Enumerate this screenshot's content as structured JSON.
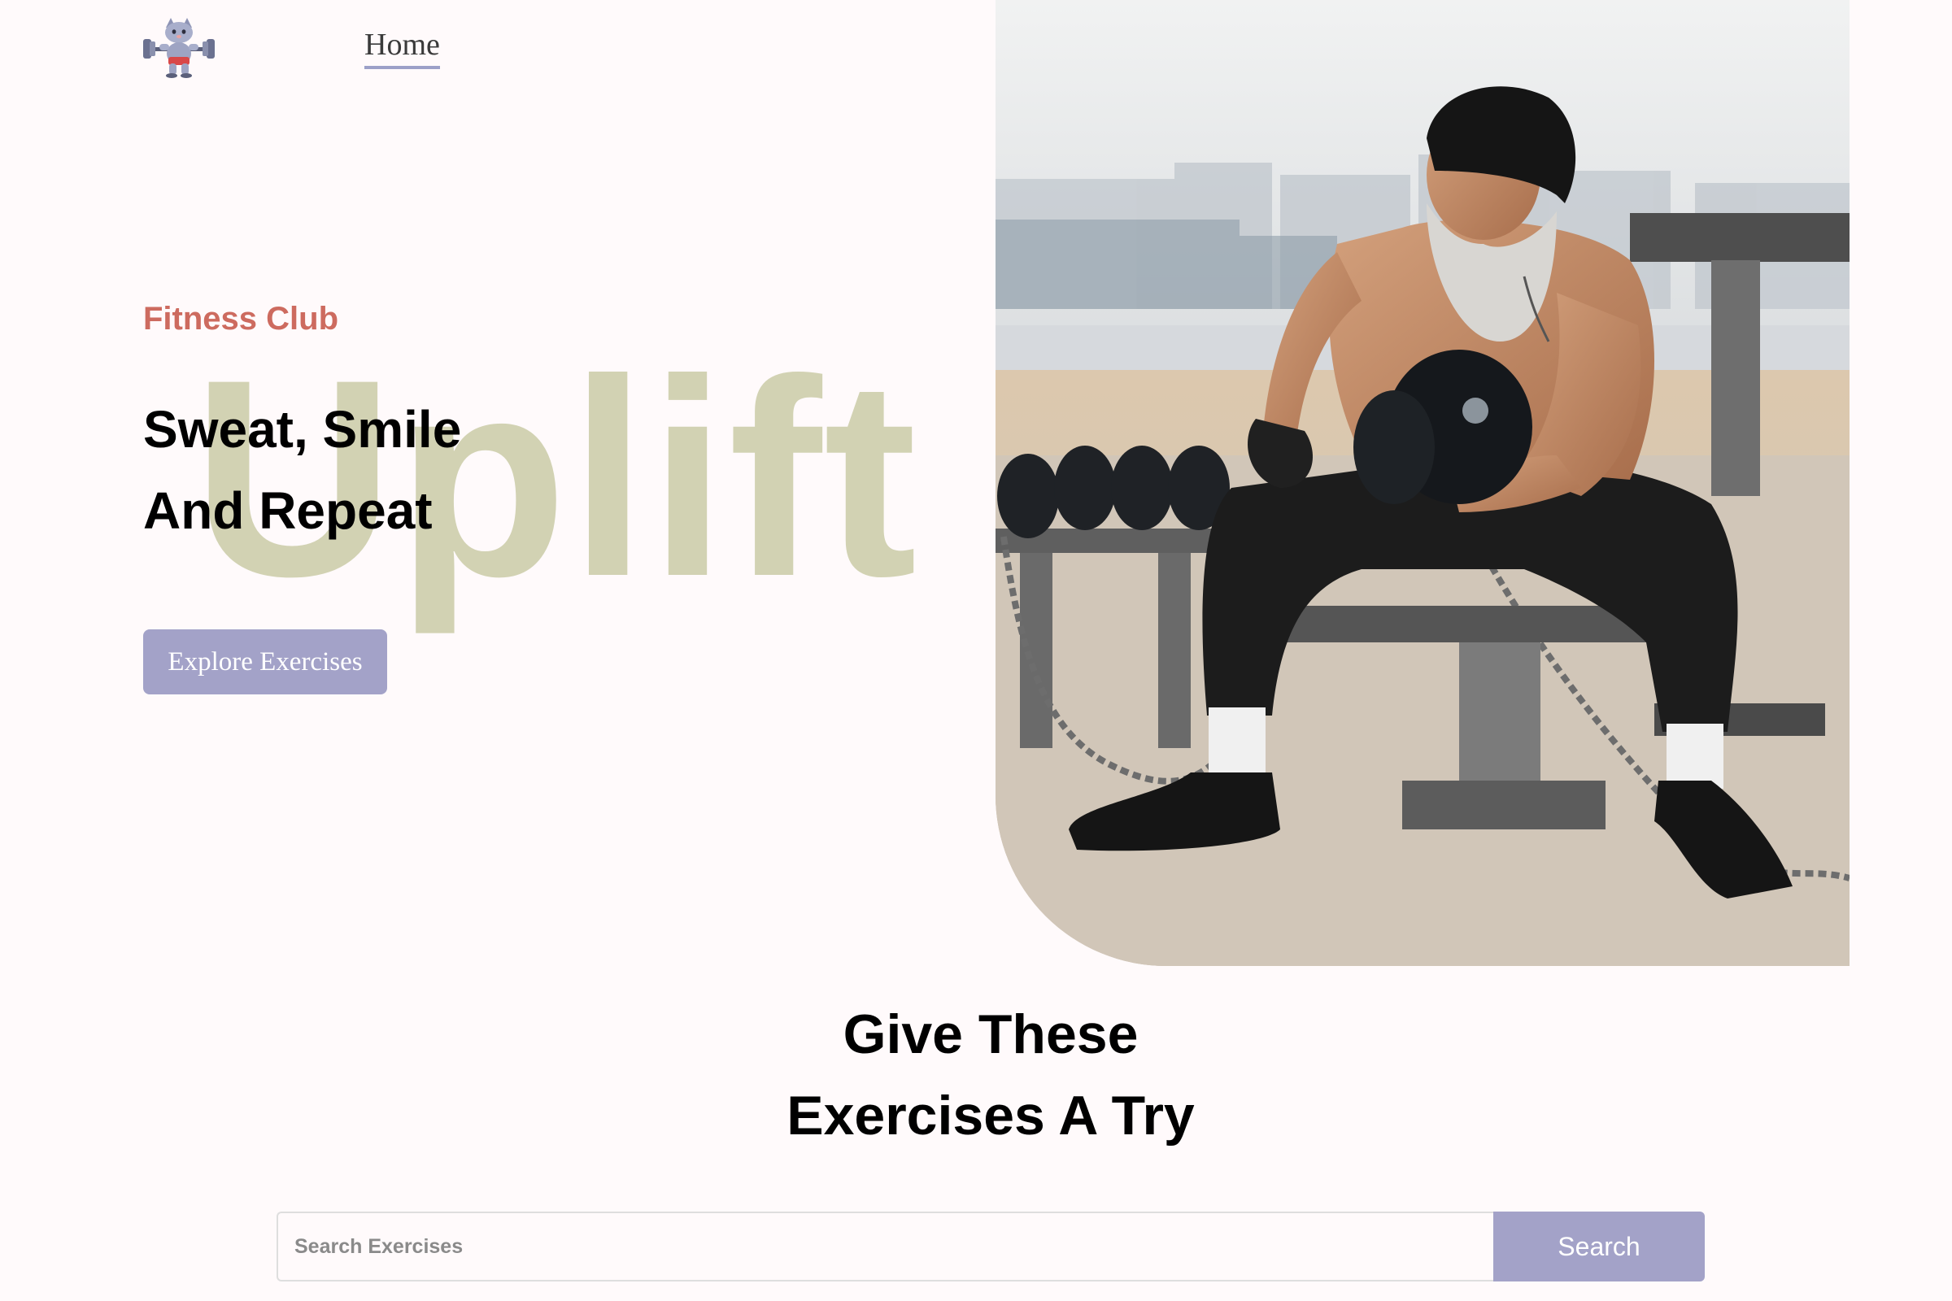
{
  "nav": {
    "logo_icon": "weightlifting-cat-logo-icon",
    "home_label": "Home"
  },
  "hero": {
    "kicker": "Fitness Club",
    "title_line1": "Sweat, Smile",
    "title_line2": "And Repeat",
    "background_word": "Uplift",
    "cta_label": "Explore Exercises",
    "image": "man-lifting-dumbbell-photo"
  },
  "exercises": {
    "title_line1": "Give These",
    "title_line2": "Exercises A Try",
    "search_placeholder": "Search Exercises",
    "search_button": "Search"
  },
  "colors": {
    "background": "#fffafb",
    "accent": "#a3a2c8",
    "kicker": "#cd6b5f",
    "watermark": "#d2d2b3"
  }
}
